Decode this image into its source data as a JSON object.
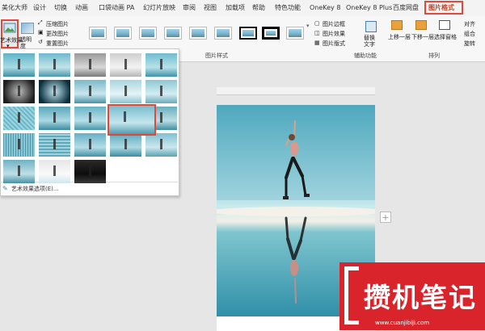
{
  "tabs": [
    "美化大师",
    "设计",
    "切换",
    "动画",
    "口袋动画 PA",
    "幻灯片放映",
    "审阅",
    "视图",
    "加载项",
    "帮助",
    "特色功能",
    "OneKey 8",
    "OneKey 8 Plus",
    "百度网盘",
    "图片格式"
  ],
  "active_tab": "图片格式",
  "ribbon": {
    "artistic_effects": "艺术效果",
    "transparency": "透明度",
    "compress": "压缩图片",
    "change_picture": "更改图片",
    "reset_picture": "重置图片",
    "picture_border": "图片边框",
    "picture_effects": "图片效果",
    "picture_layout": "图片版式",
    "alt_text": "辅助功能",
    "alt_text_btn": "替换文字",
    "bring_forward": "上移一层",
    "send_backward": "下移一层",
    "selection_pane": "选择窗格",
    "align": "对齐",
    "group": "组合",
    "rotate": "旋转",
    "group_styles": "图片样式",
    "group_arrange": "排列"
  },
  "panel": {
    "footer": "艺术效果选项(E)..."
  },
  "watermark": {
    "text": "攒机笔记",
    "url": "www.cuanjibiji.com"
  },
  "colors": {
    "accent": "#c43e1c",
    "highlight": "#e0483b",
    "watermark": "#d9242c"
  }
}
